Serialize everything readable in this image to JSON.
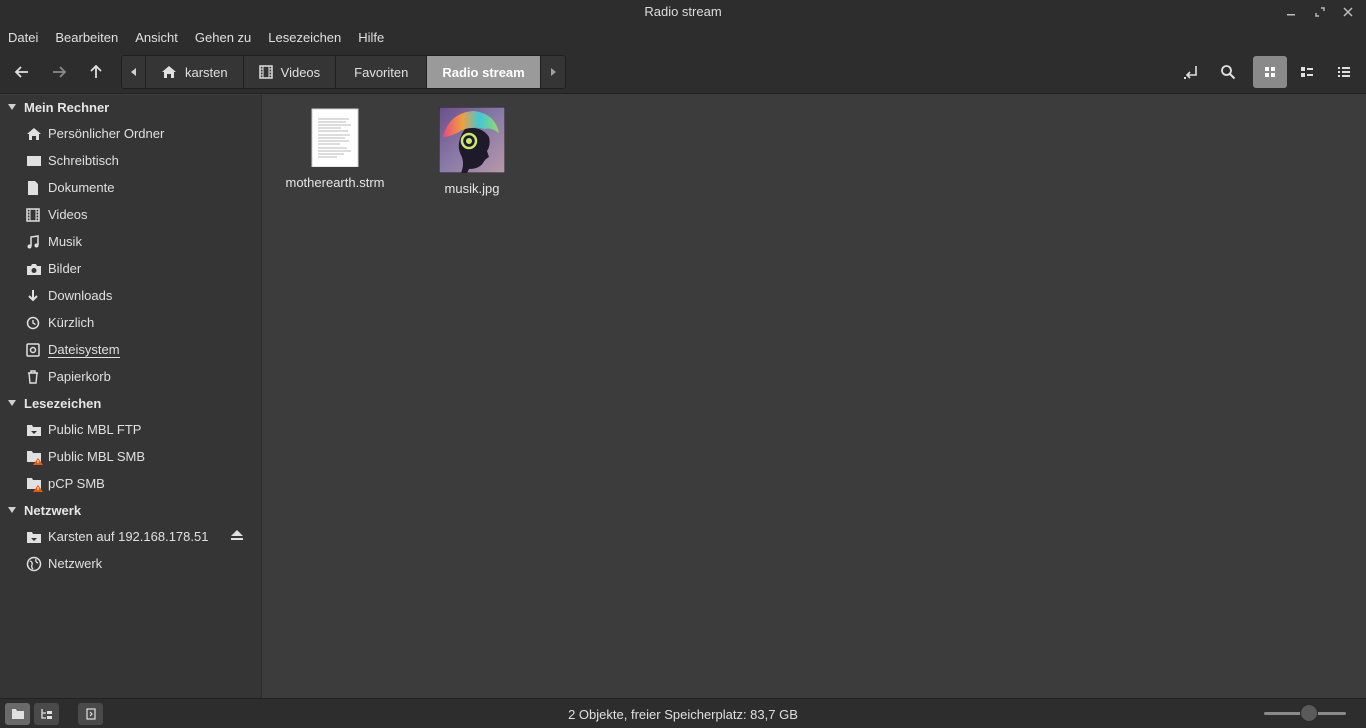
{
  "window": {
    "title": "Radio stream"
  },
  "menu": [
    "Datei",
    "Bearbeiten",
    "Ansicht",
    "Gehen zu",
    "Lesezeichen",
    "Hilfe"
  ],
  "breadcrumbs": [
    {
      "label": "karsten",
      "icon": "home-icon"
    },
    {
      "label": "Videos",
      "icon": "film-icon"
    },
    {
      "label": "Favoriten",
      "icon": ""
    },
    {
      "label": "Radio stream",
      "icon": "",
      "active": true
    }
  ],
  "sidebar": {
    "sections": [
      {
        "title": "Mein Rechner",
        "items": [
          {
            "label": "Persönlicher Ordner",
            "icon": "home-icon"
          },
          {
            "label": "Schreibtisch",
            "icon": "desktop-icon"
          },
          {
            "label": "Dokumente",
            "icon": "document-icon"
          },
          {
            "label": "Videos",
            "icon": "film-icon"
          },
          {
            "label": "Musik",
            "icon": "music-note-icon"
          },
          {
            "label": "Bilder",
            "icon": "camera-icon"
          },
          {
            "label": "Downloads",
            "icon": "download-arrow-icon"
          },
          {
            "label": "Kürzlich",
            "icon": "clock-icon"
          },
          {
            "label": "Dateisystem",
            "icon": "drive-icon"
          },
          {
            "label": "Papierkorb",
            "icon": "trash-icon"
          }
        ]
      },
      {
        "title": "Lesezeichen",
        "items": [
          {
            "label": "Public MBL FTP",
            "icon": "network-folder-icon"
          },
          {
            "label": "Public MBL SMB",
            "icon": "network-folder-warning-icon"
          },
          {
            "label": "pCP SMB",
            "icon": "network-folder-warning-icon"
          }
        ]
      },
      {
        "title": "Netzwerk",
        "items": [
          {
            "label": "Karsten auf 192.168.178.51",
            "icon": "network-folder-icon"
          },
          {
            "label": "Netzwerk",
            "icon": "globe-icon"
          }
        ]
      }
    ]
  },
  "files": [
    {
      "name": "motherearth.strm",
      "icon": "text-file-icon"
    },
    {
      "name": "musik.jpg",
      "icon": "image-thumbnail-icon"
    }
  ],
  "status": {
    "text": "2 Objekte, freier Speicherplatz: 83,7 GB",
    "zoom_fraction": 0.55
  },
  "colors": {
    "accent": "#9a9a9a",
    "background": "#3c3c3c",
    "sidebar": "#353535",
    "bar": "#2d2d2d"
  }
}
